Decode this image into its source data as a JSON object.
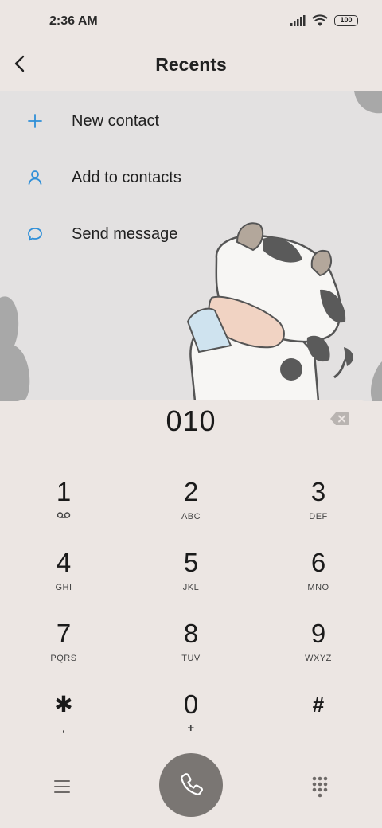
{
  "status": {
    "time": "2:36 AM",
    "battery": "100"
  },
  "header": {
    "title": "Recents"
  },
  "menu": [
    {
      "label": "New contact",
      "icon": "plus-icon"
    },
    {
      "label": "Add to contacts",
      "icon": "person-icon"
    },
    {
      "label": "Send message",
      "icon": "message-bubble-icon"
    }
  ],
  "dialer": {
    "number": "010",
    "keys": [
      {
        "digit": "1",
        "letters": "voicemail-icon"
      },
      {
        "digit": "2",
        "letters": "ABC"
      },
      {
        "digit": "3",
        "letters": "DEF"
      },
      {
        "digit": "4",
        "letters": "GHI"
      },
      {
        "digit": "5",
        "letters": "JKL"
      },
      {
        "digit": "6",
        "letters": "MNO"
      },
      {
        "digit": "7",
        "letters": "PQRS"
      },
      {
        "digit": "8",
        "letters": "TUV"
      },
      {
        "digit": "9",
        "letters": "WXYZ"
      },
      {
        "digit": "✱",
        "letters": ","
      },
      {
        "digit": "0",
        "letters": "+"
      },
      {
        "digit": "#",
        "letters": ""
      }
    ]
  },
  "colors": {
    "accent": "#2f8fd8",
    "background": "#ece6e3",
    "call_button": "#7a7673"
  }
}
